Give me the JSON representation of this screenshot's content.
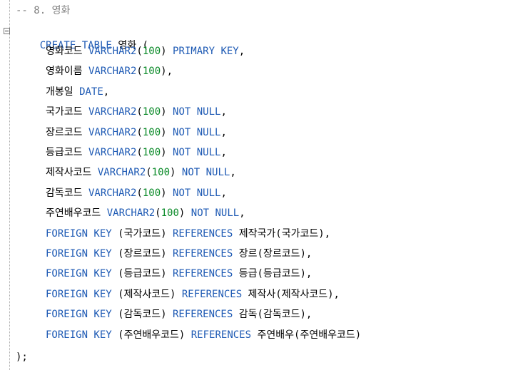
{
  "editor": {
    "comment": "-- 8. 영화",
    "create_line": {
      "kw": "CREATE TABLE",
      "table": "영화",
      "open": "("
    },
    "columns": [
      {
        "name": "영화코드",
        "type": "VARCHAR2",
        "size": "100",
        "constraint": "PRIMARY KEY"
      },
      {
        "name": "영화이름",
        "type": "VARCHAR2",
        "size": "100",
        "constraint": ""
      },
      {
        "name": "개봉일",
        "type": "DATE",
        "size": "",
        "constraint": ""
      },
      {
        "name": "국가코드",
        "type": "VARCHAR2",
        "size": "100",
        "constraint": "NOT NULL"
      },
      {
        "name": "장르코드",
        "type": "VARCHAR2",
        "size": "100",
        "constraint": "NOT NULL"
      },
      {
        "name": "등급코드",
        "type": "VARCHAR2",
        "size": "100",
        "constraint": "NOT NULL"
      },
      {
        "name": "제작사코드",
        "type": "VARCHAR2",
        "size": "100",
        "constraint": "NOT NULL"
      },
      {
        "name": "감독코드",
        "type": "VARCHAR2",
        "size": "100",
        "constraint": "NOT NULL"
      },
      {
        "name": "주연배우코드",
        "type": "VARCHAR2",
        "size": "100",
        "constraint": "NOT NULL"
      }
    ],
    "foreign_keys": [
      {
        "column": "국가코드",
        "ref_table": "제작국가",
        "ref_column": "국가코드",
        "comma": true
      },
      {
        "column": "장르코드",
        "ref_table": "장르",
        "ref_column": "장르코드",
        "comma": true
      },
      {
        "column": "등급코드",
        "ref_table": "등급",
        "ref_column": "등급코드",
        "comma": true
      },
      {
        "column": "제작사코드",
        "ref_table": "제작사",
        "ref_column": "제작사코드",
        "comma": true
      },
      {
        "column": "감독코드",
        "ref_table": "감독",
        "ref_column": "감독코드",
        "comma": true
      },
      {
        "column": "주연배우코드",
        "ref_table": "주연배우",
        "ref_column": "주연배우코드",
        "comma": false
      }
    ],
    "fk_keyword": "FOREIGN KEY",
    "ref_keyword": "REFERENCES",
    "close": ");",
    "colors": {
      "keyword": "#1e5ab4",
      "number": "#0a8a28",
      "comment": "#808080"
    }
  }
}
